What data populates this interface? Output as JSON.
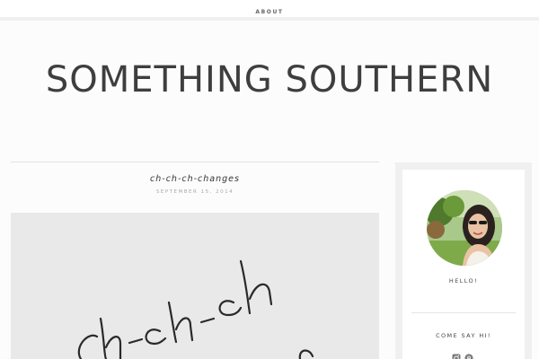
{
  "nav": {
    "about_label": "ABOUT"
  },
  "site": {
    "title": "SOMETHING SOUTHERN"
  },
  "post": {
    "title": "ch-ch-ch-changes",
    "date": "SEPTEMBER 15, 2014",
    "image_text": "ch-ch-ch"
  },
  "sidebar": {
    "hello_label": "HELLO!",
    "come_say_hi_label": "COME SAY HI!",
    "social_icons": [
      "instagram-icon",
      "pinterest-icon"
    ]
  },
  "colors": {
    "title": "#3e3e3e",
    "background": "#fcfcfc",
    "sidebar_frame": "#f0f0f0"
  }
}
